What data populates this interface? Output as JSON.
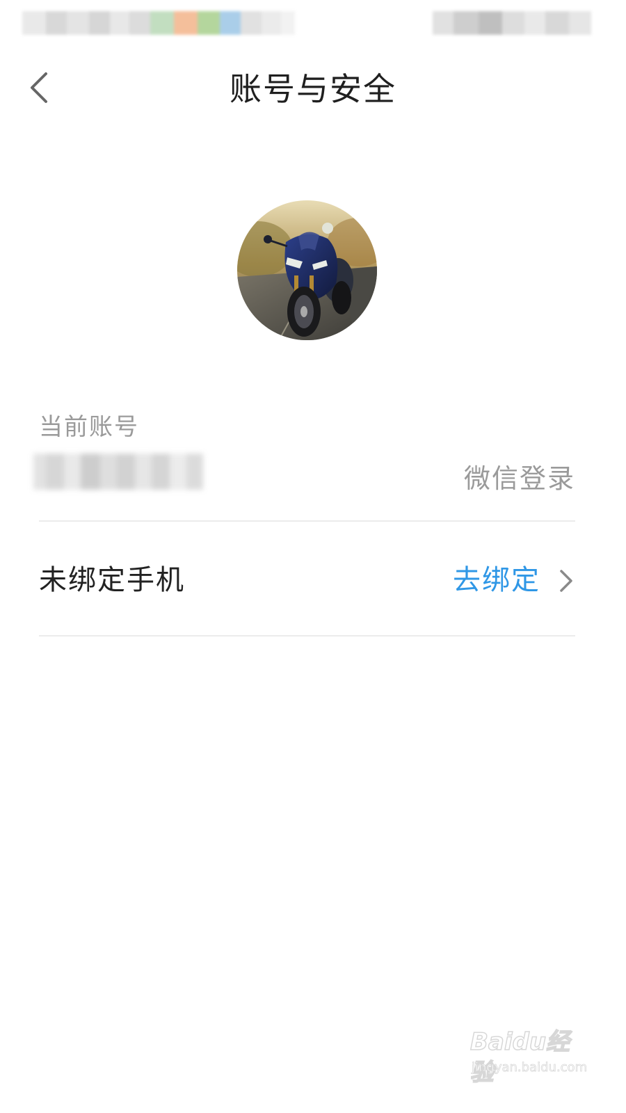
{
  "header": {
    "title": "账号与安全"
  },
  "account": {
    "label": "当前账号",
    "login_method": "微信登录"
  },
  "phone_binding": {
    "status": "未绑定手机",
    "action": "去绑定"
  },
  "watermark": {
    "logo": "Baidu经验",
    "url": "jingyan.baidu.com"
  },
  "icons": {
    "back": "back-arrow-icon",
    "chevron": "chevron-right-icon"
  },
  "colors": {
    "accent": "#2f97e6",
    "muted_text": "#9a9a9a",
    "primary_text": "#222222",
    "divider": "#ececec"
  }
}
